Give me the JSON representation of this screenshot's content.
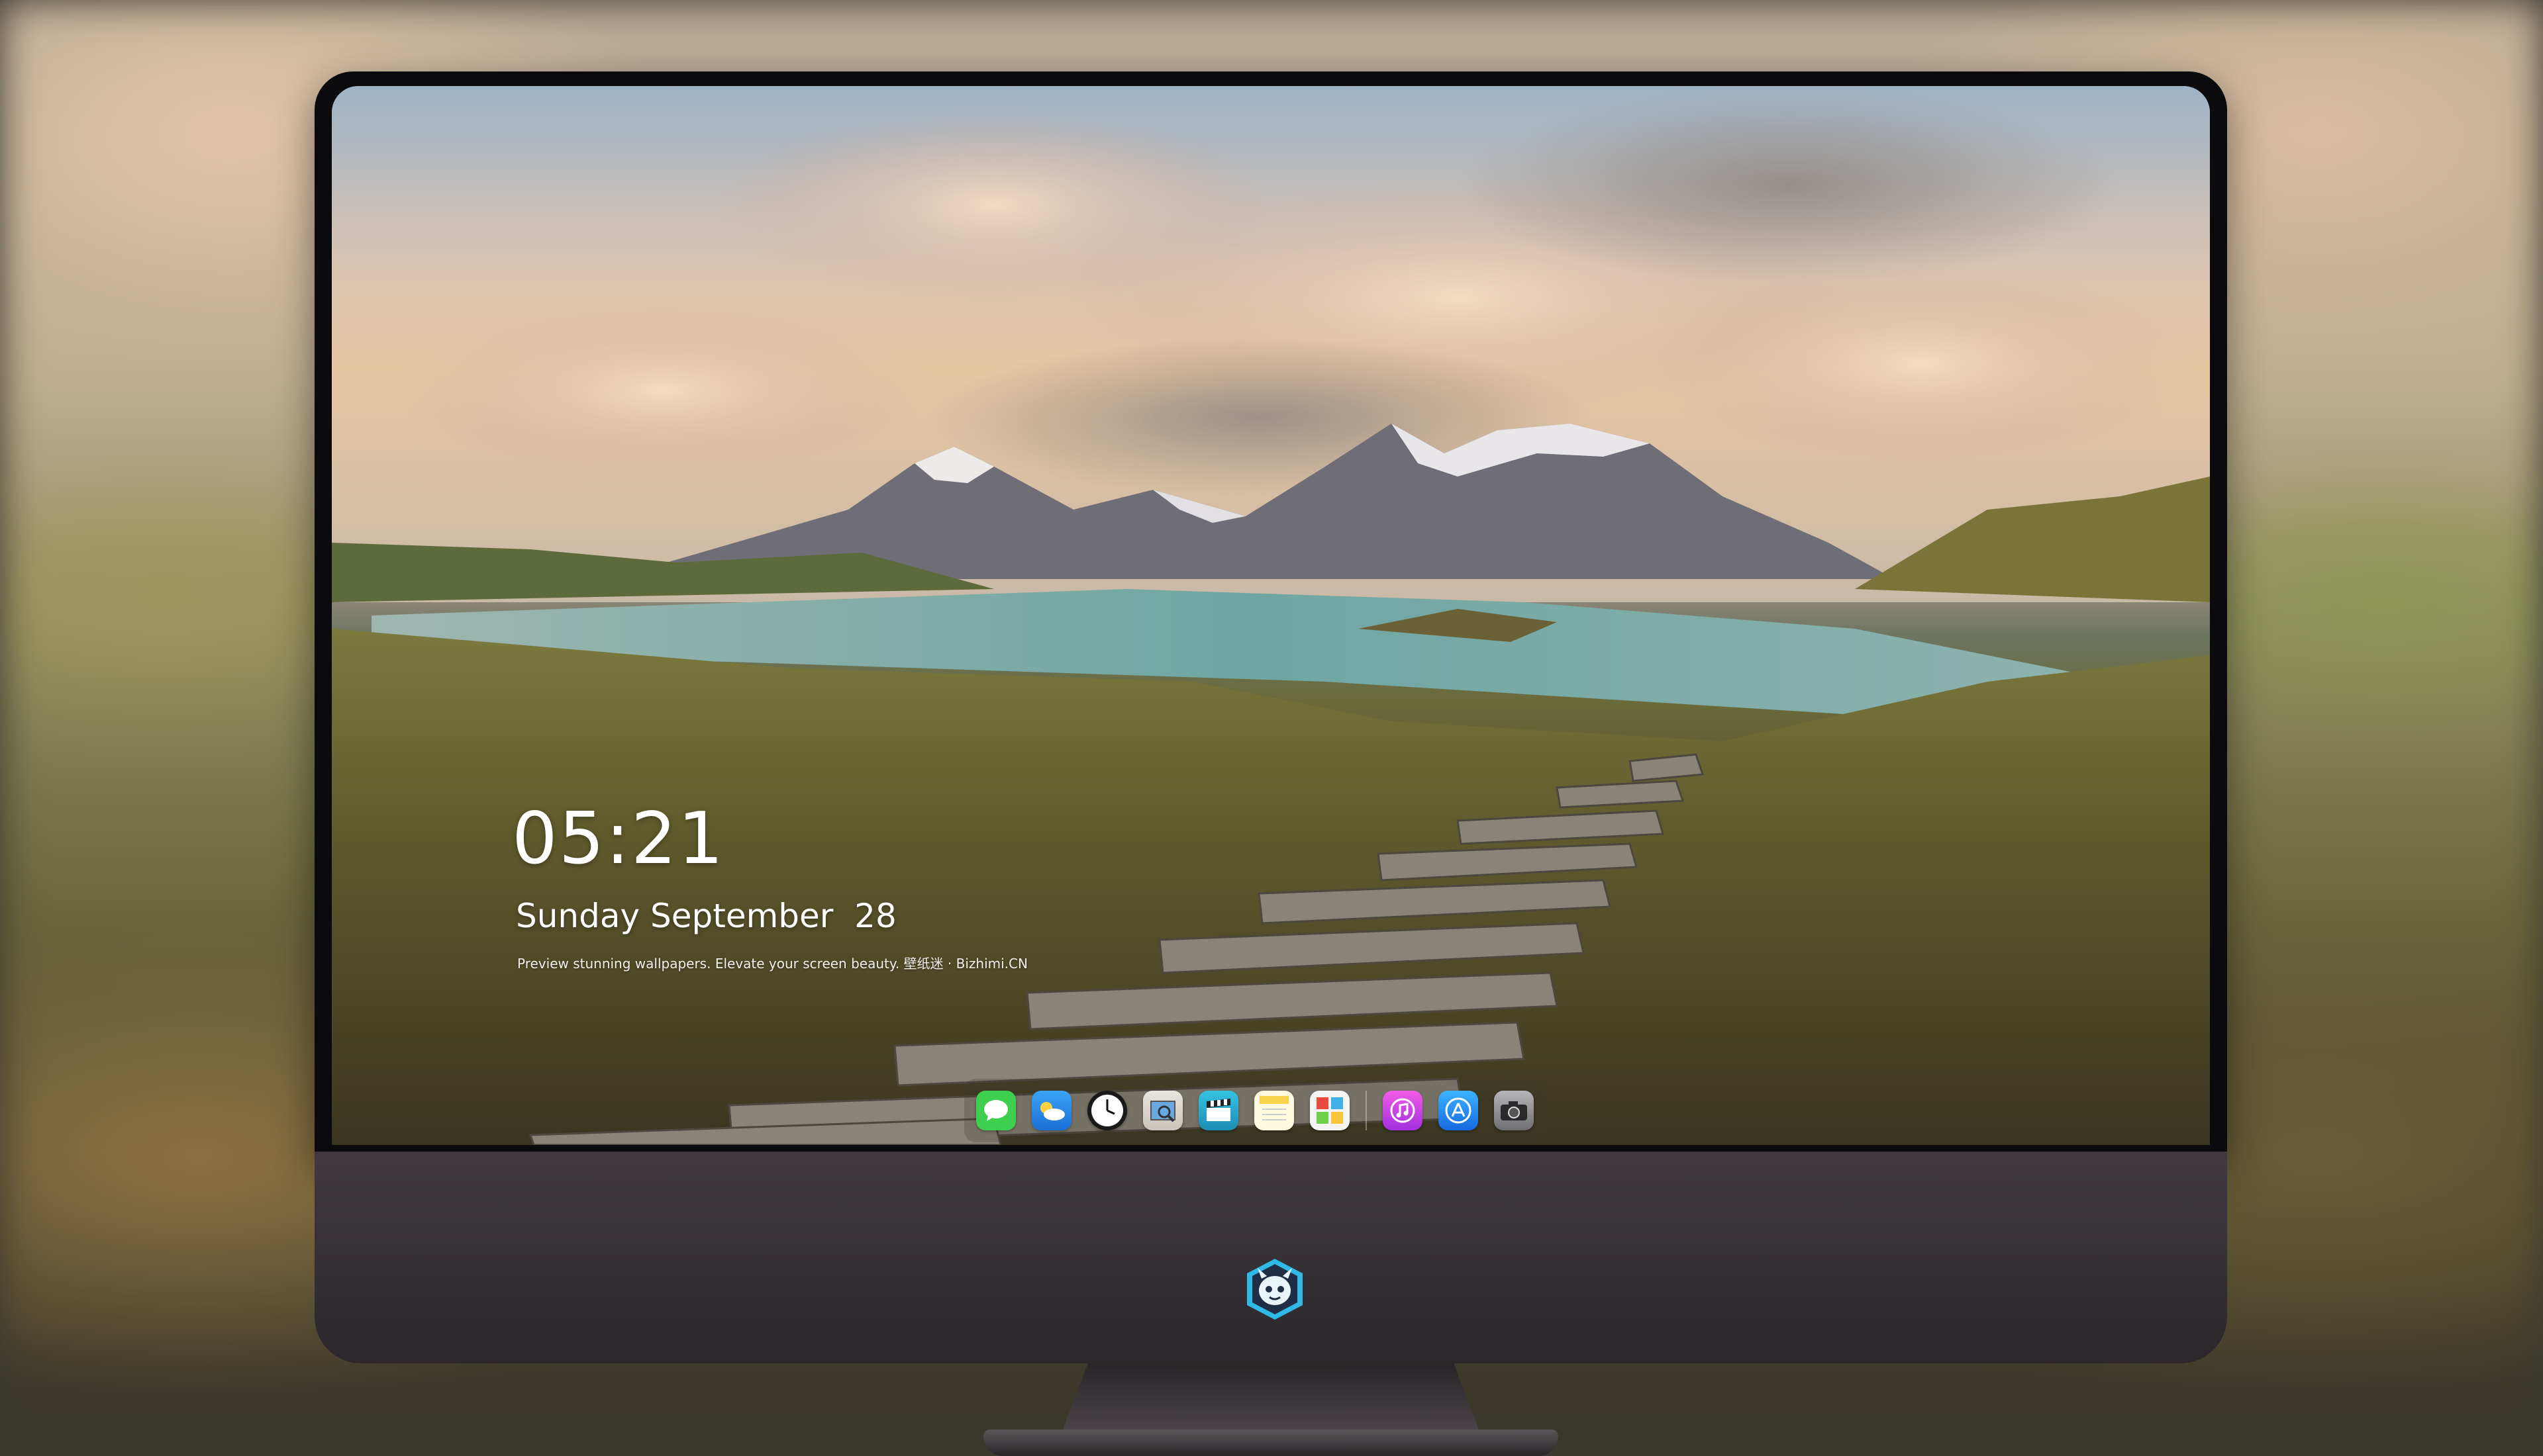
{
  "lockscreen": {
    "time": "05:21",
    "date": "Sunday September  28",
    "tagline": "Preview stunning wallpapers. Elevate your screen beauty. 壁纸迷 · Bizhimi.CN"
  },
  "dock": {
    "apps": [
      {
        "name": "messages-icon",
        "color": "#3fcf4e"
      },
      {
        "name": "weather-icon",
        "color": "#2b8fe8"
      },
      {
        "name": "clock-icon",
        "color": "#1a1a1a"
      },
      {
        "name": "preview-icon",
        "color": "#6aa9e0"
      },
      {
        "name": "final-cut-icon",
        "color": "#27b6d6"
      },
      {
        "name": "notes-icon",
        "color": "#f7d24a"
      },
      {
        "name": "photo-booth-icon",
        "color": "#e84a3f"
      },
      {
        "name": "music-icon",
        "color": "#d63cf0"
      },
      {
        "name": "app-store-icon",
        "color": "#1d8ff0"
      },
      {
        "name": "camera-icon",
        "color": "#8e8e92"
      }
    ]
  },
  "brand_logo": "dragon-mascot-logo"
}
